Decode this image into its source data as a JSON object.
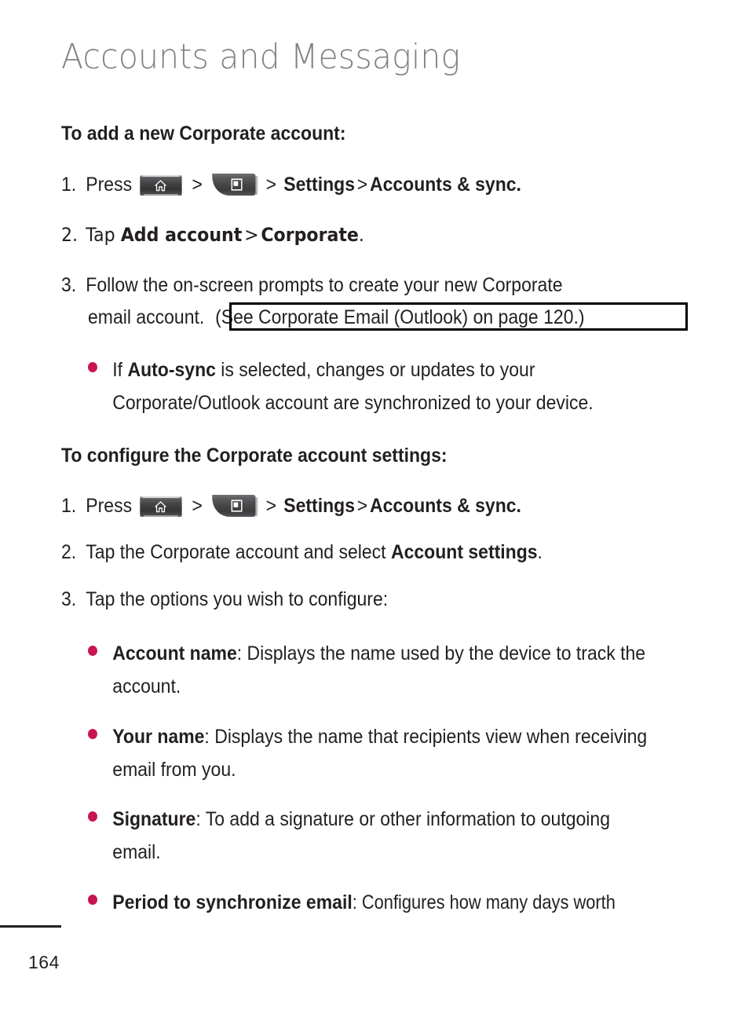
{
  "page": {
    "chapter_title": "Accounts and Messaging",
    "page_number": "164",
    "bullet_color": "#c81450",
    "text_color": "#231f20",
    "title_color": "#808285"
  },
  "icons": {
    "home_key": "home-key-icon",
    "menu_key": "menu-key-icon"
  },
  "section1": {
    "heading": "To add a new Corporate account:",
    "steps": [
      {
        "num": "1.",
        "lead": "Press",
        "sep1": ">",
        "sep2": ">",
        "sep3": ">",
        "bold1": "Settings",
        "bold2": "Accounts & sync."
      },
      {
        "num": "2.",
        "lead": "Tap",
        "bold1": "Add account",
        "sep1": ">",
        "bold2": "Corporate",
        "tail": "."
      },
      {
        "num": "3.",
        "line1": "Follow the on-screen prompts to create your new Corporate",
        "line2_plain": "email account.",
        "line2_boxed": "(See Corporate Email (Outlook) on page 120.)"
      }
    ],
    "bullets": [
      {
        "pre": "If ",
        "bold": "Auto-sync",
        "post": " is selected, changes or updates to your Corporate/Outlook account are synchronized to your device."
      }
    ]
  },
  "section2": {
    "heading": "To configure the Corporate account settings:",
    "steps": [
      {
        "num": "1.",
        "lead": "Press",
        "sep1": ">",
        "sep2": ">",
        "sep3": ">",
        "bold1": "Settings",
        "bold2": "Accounts & sync."
      },
      {
        "num": "2.",
        "pre": "Tap the Corporate account and select ",
        "bold": "Account settings",
        "post": "."
      },
      {
        "num": "3.",
        "text": "Tap the options you wish to configure:"
      }
    ],
    "bullets": [
      {
        "bold": "Account name",
        "post": ": Displays the name used by the device to track the account."
      },
      {
        "bold": "Your name",
        "post": ": Displays the name that recipients view when receiving email from you."
      },
      {
        "bold": "Signature",
        "post": ": To add a signature or other information to outgoing email."
      },
      {
        "bold": "Period to synchronize email",
        "post": ": Configures how many days worth"
      }
    ]
  }
}
